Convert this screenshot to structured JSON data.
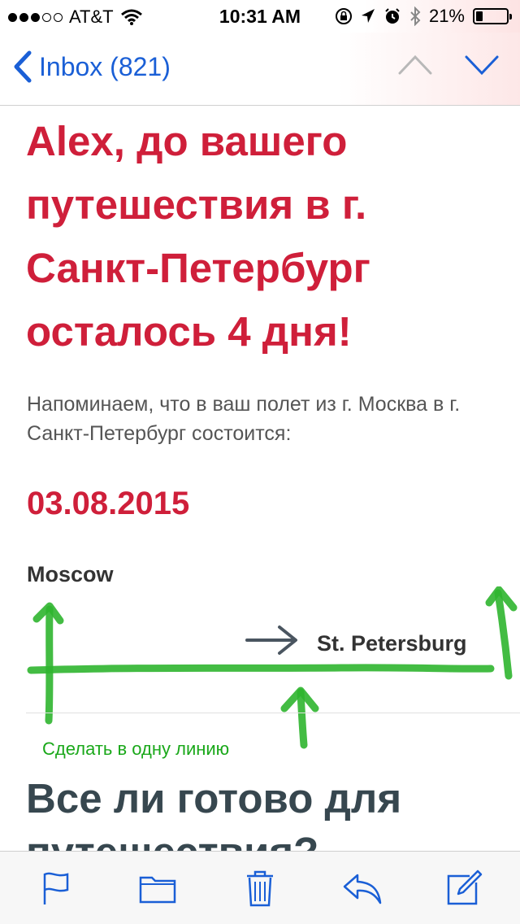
{
  "status_bar": {
    "carrier": "AT&T",
    "signal_bars_filled": 3,
    "signal_bars_total": 5,
    "time": "10:31 AM",
    "battery_percent": "21%",
    "battery_level": 0.21,
    "icons": [
      "wifi-icon",
      "rotation-lock-icon",
      "location-icon",
      "alarm-icon",
      "bluetooth-icon",
      "battery-icon"
    ]
  },
  "nav": {
    "back_label": "Inbox (821)",
    "icons": [
      "back-chevron-icon",
      "previous-message-icon",
      "next-message-icon"
    ]
  },
  "email": {
    "headline": "Alex, до вашего путешествия в г. Санкт-Петербург осталось 4 дня!",
    "reminder": "Напоминаем, что в ваш полет из г. Москва в г. Санкт-Петербург состоится:",
    "flight_date": "03.08.2015",
    "origin": "Moscow",
    "destination": "St. Petersburg",
    "annotation_note": "Сделать в одну линию",
    "section_title": "Все ли готово для путешествия?"
  },
  "colors": {
    "accent": "#cf1f3a",
    "link": "#1a5fd6",
    "annotation": "#1aa81a",
    "section_title": "#37474f"
  },
  "toolbar": {
    "icons": [
      "flag-icon",
      "folder-icon",
      "trash-icon",
      "reply-icon",
      "compose-icon"
    ]
  }
}
